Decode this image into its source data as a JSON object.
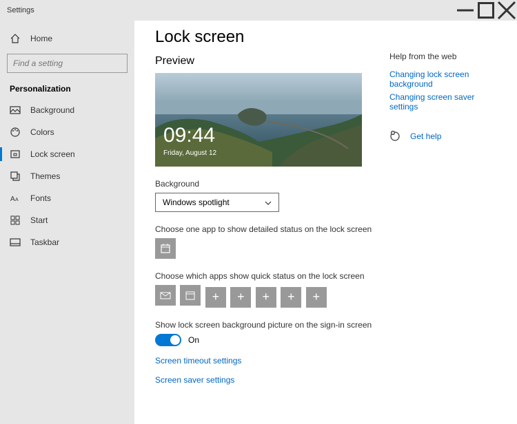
{
  "window": {
    "title": "Settings"
  },
  "sidebar": {
    "home": "Home",
    "search_placeholder": "Find a setting",
    "section": "Personalization",
    "items": [
      {
        "label": "Background"
      },
      {
        "label": "Colors"
      },
      {
        "label": "Lock screen"
      },
      {
        "label": "Themes"
      },
      {
        "label": "Fonts"
      },
      {
        "label": "Start"
      },
      {
        "label": "Taskbar"
      }
    ]
  },
  "page": {
    "title": "Lock screen",
    "preview_heading": "Preview",
    "preview_time": "09:44",
    "preview_date": "Friday, August 12",
    "background_label": "Background",
    "background_value": "Windows spotlight",
    "detailed_status_label": "Choose one app to show detailed status on the lock screen",
    "quick_status_label": "Choose which apps show quick status on the lock screen",
    "signin_bg_label": "Show lock screen background picture on the sign-in screen",
    "toggle_state": "On",
    "link_timeout": "Screen timeout settings",
    "link_saver": "Screen saver settings"
  },
  "help": {
    "heading": "Help from the web",
    "links": [
      "Changing lock screen background",
      "Changing screen saver settings"
    ],
    "get_help": "Get help"
  }
}
